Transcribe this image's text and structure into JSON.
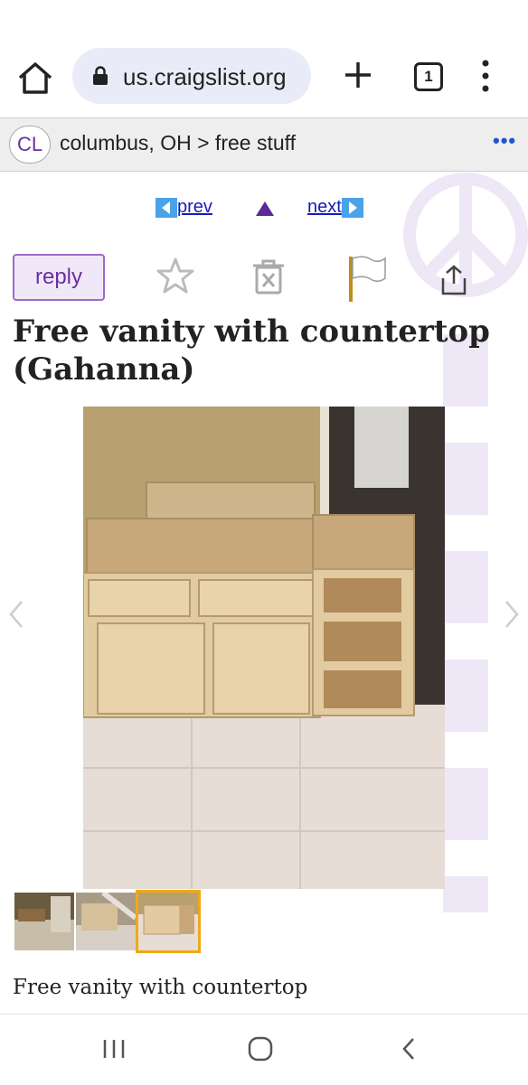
{
  "browser": {
    "url": "us.craigslist.org",
    "tab_count": "1",
    "icons": [
      "home-icon",
      "lock-icon",
      "plus-icon",
      "tabs-icon",
      "more-vertical-icon"
    ]
  },
  "header": {
    "logo": "CL",
    "breadcrumb": "columbus, OH > free stuff",
    "more": "•••"
  },
  "nav": {
    "prev": "prev",
    "next": "next"
  },
  "actions": {
    "reply": "reply",
    "icons": [
      "star-icon",
      "hide-icon",
      "flag-icon",
      "share-icon"
    ]
  },
  "post": {
    "title": "Free vanity with countertop (Gahanna)",
    "description": "Free vanity with countertop",
    "thumb_count": 3,
    "selected_thumb": 3
  },
  "colors": {
    "purple": "#6b2fa0",
    "link": "#1a1ab8",
    "thumb_selected": "#f0a818"
  }
}
